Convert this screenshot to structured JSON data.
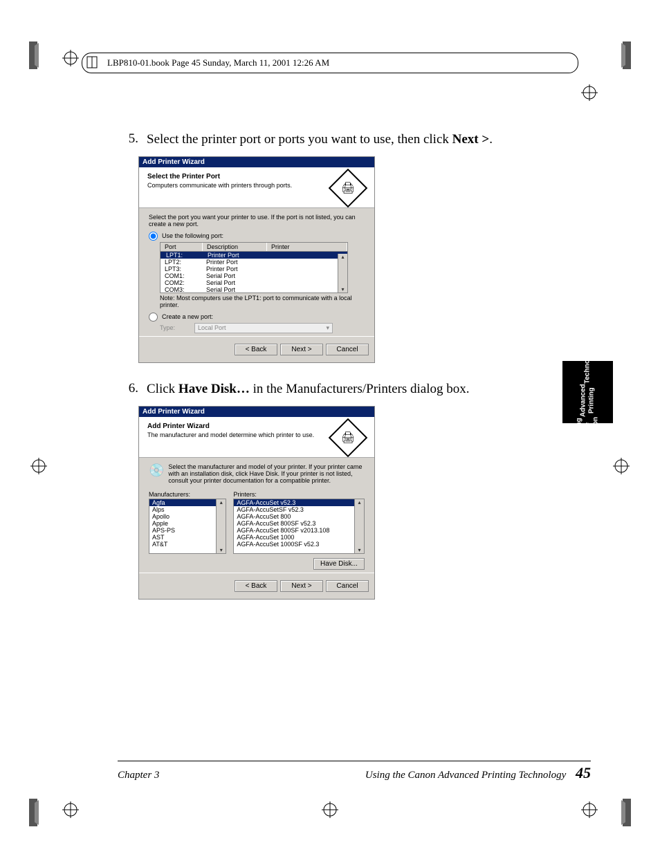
{
  "header": "LBP810-01.book  Page 45  Sunday, March 11, 2001  12:26 AM",
  "step5": {
    "num": "5.",
    "pre": "Select the printer port or ports you want to use, then click ",
    "bold": "Next >",
    "post": "."
  },
  "step6": {
    "num": "6.",
    "pre": "Click ",
    "bold": "Have Disk…",
    "post": " in the Manufacturers/Printers dialog box."
  },
  "wiz1": {
    "title": "Add Printer Wizard",
    "heading": "Select the Printer Port",
    "sub": "Computers communicate with printers through ports.",
    "instr": "Select the port you want your printer to use.  If the port is not listed, you can create a new port.",
    "r1": "Use the following port:",
    "cols": {
      "c1": "Port",
      "c2": "Description",
      "c3": "Printer"
    },
    "rows": [
      {
        "c1": "LPT1:",
        "c2": "Printer Port",
        "c3": ""
      },
      {
        "c1": "LPT2:",
        "c2": "Printer Port",
        "c3": ""
      },
      {
        "c1": "LPT3:",
        "c2": "Printer Port",
        "c3": ""
      },
      {
        "c1": "COM1:",
        "c2": "Serial Port",
        "c3": ""
      },
      {
        "c1": "COM2:",
        "c2": "Serial Port",
        "c3": ""
      },
      {
        "c1": "COM3:",
        "c2": "Serial Port",
        "c3": ""
      }
    ],
    "note": "Note: Most computers use the LPT1: port to communicate with a local printer.",
    "r2": "Create a new port:",
    "typel": "Type:",
    "typev": "Local Port",
    "back": "< Back",
    "next": "Next >",
    "cancel": "Cancel"
  },
  "wiz2": {
    "title": "Add Printer Wizard",
    "heading": "Add Printer Wizard",
    "sub": "The manufacturer and model determine which printer to use.",
    "instr": "Select the manufacturer and model of your printer. If your printer came with an installation disk, click Have Disk. If your printer is not listed, consult your printer documentation for a compatible printer.",
    "mlab": "Manufacturers:",
    "plab": "Printers:",
    "m": [
      "Agfa",
      "Alps",
      "Apollo",
      "Apple",
      "APS-PS",
      "AST",
      "AT&T"
    ],
    "p": [
      "AGFA-AccuSet v52.3",
      "AGFA-AccuSetSF v52.3",
      "AGFA-AccuSet 800",
      "AGFA-AccuSet 800SF v52.3",
      "AGFA-AccuSet 800SF v2013.108",
      "AGFA-AccuSet 1000",
      "AGFA-AccuSet 1000SF v52.3"
    ],
    "hd": "Have Disk...",
    "back": "< Back",
    "next": "Next >",
    "cancel": "Cancel"
  },
  "tab": {
    "l1": "Using the Canon",
    "l2": "Advanced Printing",
    "l3": "Technology"
  },
  "footer": {
    "ch": "Chapter 3",
    "title": "Using the Canon Advanced Printing Technology",
    "pg": "45"
  }
}
